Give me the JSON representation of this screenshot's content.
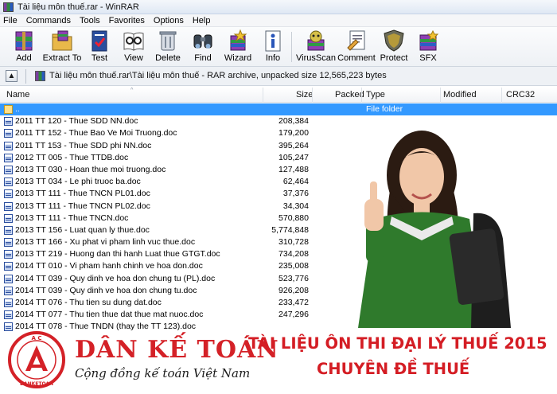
{
  "window": {
    "title": "Tài liệu môn thuế.rar - WinRAR"
  },
  "menu": [
    "File",
    "Commands",
    "Tools",
    "Favorites",
    "Options",
    "Help"
  ],
  "toolbar": [
    {
      "label": "Add",
      "icon": "add-archive-icon"
    },
    {
      "label": "Extract To",
      "icon": "extract-to-icon"
    },
    {
      "label": "Test",
      "icon": "test-icon"
    },
    {
      "label": "View",
      "icon": "view-icon"
    },
    {
      "label": "Delete",
      "icon": "delete-icon"
    },
    {
      "label": "Find",
      "icon": "find-icon"
    },
    {
      "label": "Wizard",
      "icon": "wizard-icon"
    },
    {
      "label": "Info",
      "icon": "info-icon"
    },
    {
      "label": "VirusScan",
      "icon": "virusscan-icon"
    },
    {
      "label": "Comment",
      "icon": "comment-icon"
    },
    {
      "label": "Protect",
      "icon": "protect-icon"
    },
    {
      "label": "SFX",
      "icon": "sfx-icon"
    }
  ],
  "address": {
    "path": "Tài liệu môn thuế.rar\\Tài liệu môn thuế - RAR archive, unpacked size 12,565,223 bytes"
  },
  "columns": {
    "name": "Name",
    "size": "Size",
    "packed": "Packed",
    "type": "Type",
    "modified": "Modified",
    "crc": "CRC32"
  },
  "parent_row": {
    "name": "..",
    "type": "File folder"
  },
  "files": [
    {
      "name": "2011 TT 120 - Thue SDD NN.doc",
      "size": "208,384"
    },
    {
      "name": "2011 TT 152 - Thue Bao Ve Moi Truong.doc",
      "size": "179,200"
    },
    {
      "name": "2011 TT 153 - Thue SDD phi NN.doc",
      "size": "395,264"
    },
    {
      "name": "2012 TT 005 - Thue TTDB.doc",
      "size": "105,247"
    },
    {
      "name": "2013 TT 030 - Hoan thue moi truong.doc",
      "size": "127,488"
    },
    {
      "name": "2013 TT 034 - Le phi truoc ba.doc",
      "size": "62,464"
    },
    {
      "name": "2013 TT 111 - Thue TNCN PL01.doc",
      "size": "37,376"
    },
    {
      "name": "2013 TT 111 - Thue TNCN PL02.doc",
      "size": "34,304"
    },
    {
      "name": "2013 TT 111 - Thue TNCN.doc",
      "size": "570,880"
    },
    {
      "name": "2013 TT 156 - Luat quan ly thue.doc",
      "size": "5,774,848"
    },
    {
      "name": "2013 TT 166 - Xu phat vi pham linh vuc thue.doc",
      "size": "310,728"
    },
    {
      "name": "2013 TT 219 - Huong dan thi hanh Luat thue GTGT.doc",
      "size": "734,208"
    },
    {
      "name": "2014 TT 010 - Vi pham hanh chinh ve hoa don.doc",
      "size": "235,008"
    },
    {
      "name": "2014 TT 039 - Quy dinh ve hoa don chung tu (PL).doc",
      "size": "523,776"
    },
    {
      "name": "2014 TT 039 - Quy dinh ve hoa don chung tu.doc",
      "size": "926,208"
    },
    {
      "name": "2014 TT 076 - Thu tien su dung dat.doc",
      "size": "233,472"
    },
    {
      "name": "2014 TT 077 - Thu tien thue dat thue mat nuoc.doc",
      "size": "247,296"
    },
    {
      "name": "2014 TT 078 - Thue TNDN (thay the TT 123).doc",
      "size": ""
    }
  ],
  "branding": {
    "logo_ring_text": "AC DANKETOAN",
    "brand": "DÂN KẾ TOÁN",
    "slogan": "Cộng đồng kế toán Việt Nam"
  },
  "promo": {
    "line1": "TÀI LIỆU ÔN THI ĐẠI LÝ THUẾ 2015",
    "line2": "CHUYÊN ĐỀ THUẾ"
  },
  "colors": {
    "selection": "#3399ff",
    "brand_red": "#d42127"
  }
}
